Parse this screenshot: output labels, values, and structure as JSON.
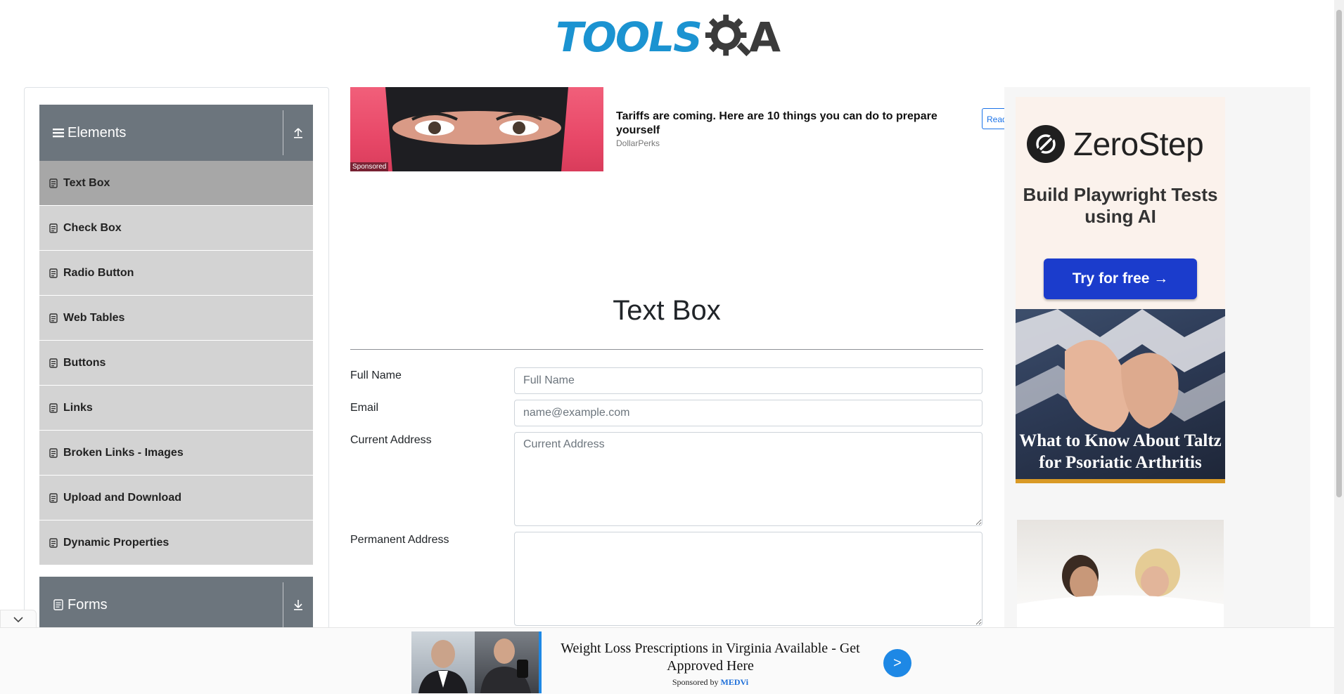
{
  "logo": {
    "part1": "TOOLS",
    "part2": "A"
  },
  "sidebar": {
    "groups": [
      {
        "title": "Elements",
        "icon": "hamburger-icon",
        "arrow": "upload-arrow-icon"
      },
      {
        "title": "Forms",
        "icon": "document-icon",
        "arrow": "download-arrow-icon"
      }
    ],
    "items": [
      {
        "label": "Text Box",
        "active": true
      },
      {
        "label": "Check Box"
      },
      {
        "label": "Radio Button"
      },
      {
        "label": "Web Tables"
      },
      {
        "label": "Buttons"
      },
      {
        "label": "Links"
      },
      {
        "label": "Broken Links - Images"
      },
      {
        "label": "Upload and Download"
      },
      {
        "label": "Dynamic Properties"
      }
    ]
  },
  "top_ad": {
    "title": "Tariffs are coming. Here are 10 things you can do to prepare yourself",
    "source": "DollarPerks",
    "button": "Read",
    "sponsored": "Sponsored"
  },
  "main": {
    "title": "Text Box",
    "fields": [
      {
        "label": "Full Name",
        "placeholder": "Full Name",
        "value": ""
      },
      {
        "label": "Email",
        "placeholder": "name@example.com",
        "value": ""
      },
      {
        "label": "Current Address",
        "placeholder": "Current Address",
        "value": ""
      },
      {
        "label": "Permanent Address",
        "placeholder": "",
        "value": ""
      }
    ]
  },
  "right_ad": {
    "brand": "ZeroStep",
    "tagline": "Build Playwright Tests using AI",
    "cta": "Try for free →",
    "article_title": "What to Know About Taltz for Psoriatic Arthritis"
  },
  "bottom_ad": {
    "title": "Weight Loss Prescriptions in Virginia Available - Get Approved Here",
    "sponsored_prefix": "Sponsored by",
    "sponsor": "MEDVi",
    "go_label": ">"
  },
  "colors": {
    "brand_blue": "#1b93d1",
    "menu_header": "#6c757d",
    "menu_item": "#d3d3d3",
    "menu_active": "#a7a7a7",
    "cta_blue": "#1b3ccc"
  }
}
